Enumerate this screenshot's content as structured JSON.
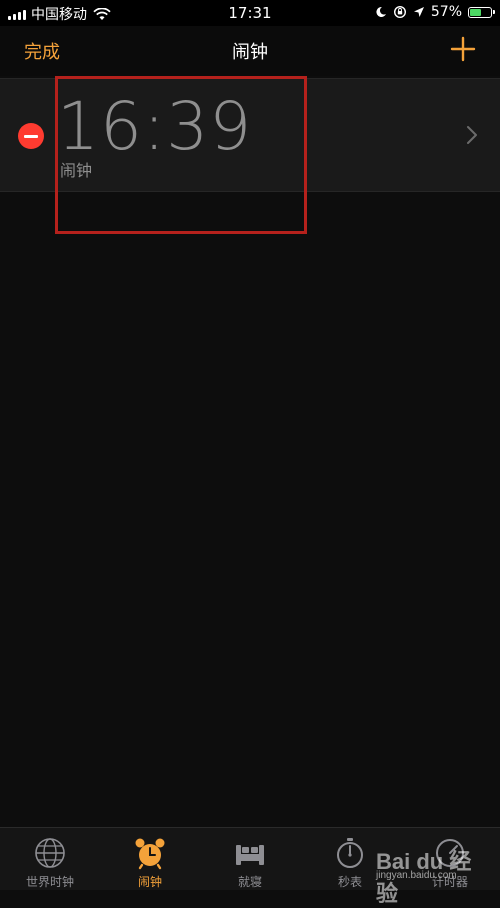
{
  "status_bar": {
    "carrier": "中国移动",
    "time": "17:31",
    "battery_percent": "57%",
    "battery_level": 0.57,
    "signal_bars": 4
  },
  "nav": {
    "left_label": "完成",
    "title": "闹钟",
    "add_icon": "plus-icon"
  },
  "alarm": {
    "time": "16:39",
    "label": "闹钟",
    "delete_icon": "minus-circle-icon",
    "chevron_icon": "chevron-right-icon"
  },
  "tabs": [
    {
      "label": "世界时钟",
      "icon": "globe-icon",
      "active": false
    },
    {
      "label": "闹钟",
      "icon": "alarm-clock-icon",
      "active": true
    },
    {
      "label": "就寝",
      "icon": "bed-icon",
      "active": false
    },
    {
      "label": "秒表",
      "icon": "stopwatch-icon",
      "active": false
    },
    {
      "label": "计时器",
      "icon": "timer-icon",
      "active": false
    }
  ],
  "watermark": {
    "brand": "Bai du 经验",
    "url": "jingyan.baidu.com"
  },
  "colors": {
    "accent": "#f4a23a",
    "delete": "#ff3b30",
    "battery": "#4cd964",
    "highlight": "#b5211c"
  }
}
